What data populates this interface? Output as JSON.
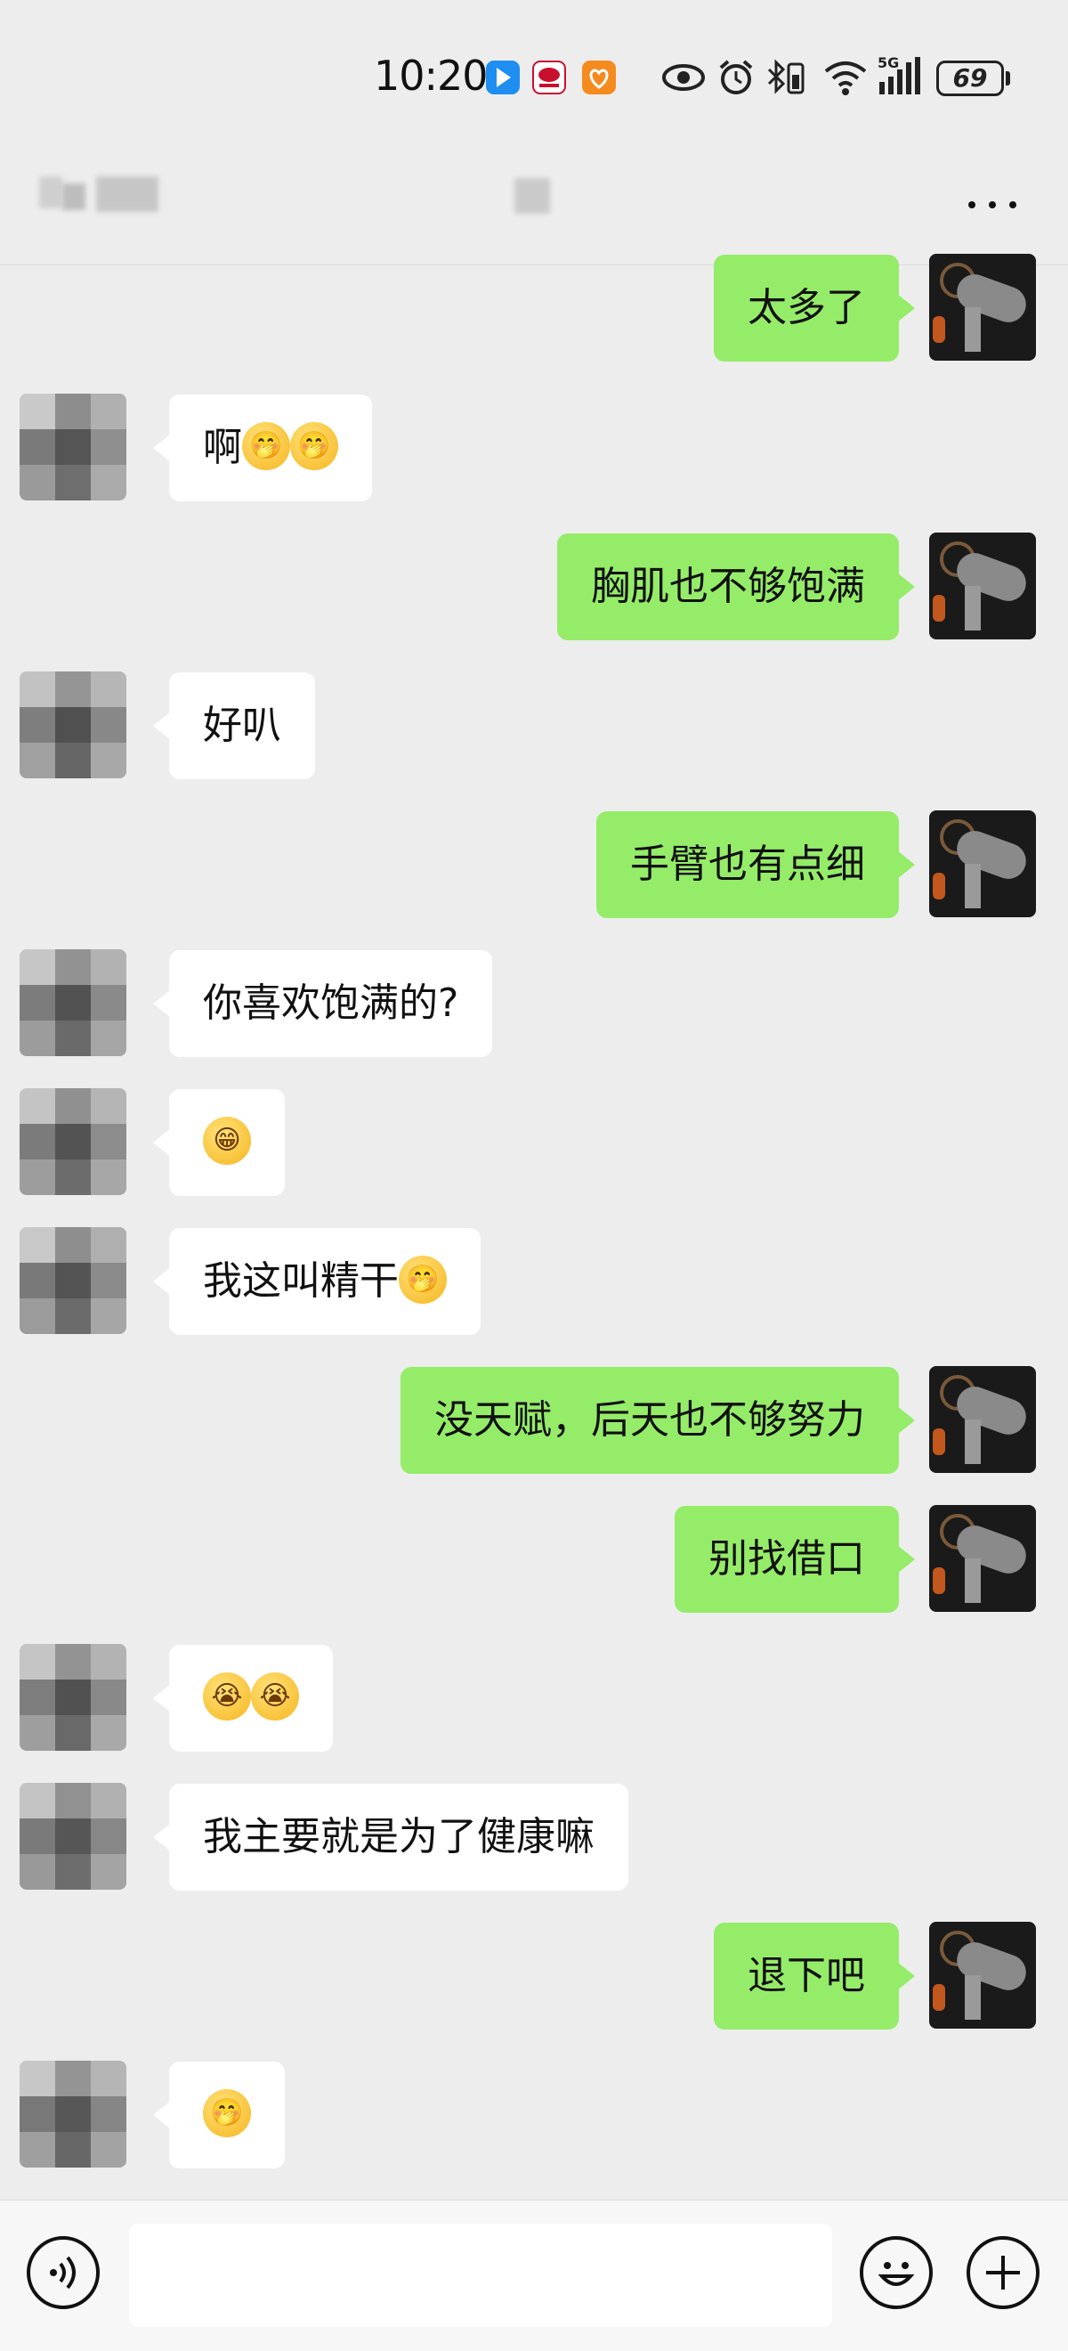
{
  "status_bar": {
    "time": "10:20",
    "network": "5G",
    "battery": "69",
    "icons": [
      "location-app-icon",
      "red-app-icon",
      "orange-app-icon",
      "eye-icon",
      "alarm-icon",
      "bluetooth-icon",
      "wifi-icon",
      "signal-icon"
    ]
  },
  "header": {
    "more_icon": "more-dots-icon"
  },
  "messages": [
    {
      "sender": "me",
      "text": "太多了"
    },
    {
      "sender": "other",
      "text": "啊",
      "emoji": [
        "🤭",
        "🤭"
      ]
    },
    {
      "sender": "me",
      "text": "胸肌也不够饱满"
    },
    {
      "sender": "other",
      "text": "好叭"
    },
    {
      "sender": "me",
      "text": "手臂也有点细"
    },
    {
      "sender": "other",
      "text": "你喜欢饱满的?"
    },
    {
      "sender": "other",
      "text": "",
      "emoji": [
        "😁"
      ]
    },
    {
      "sender": "other",
      "text": "我这叫精干",
      "emoji": [
        "🤭"
      ]
    },
    {
      "sender": "me",
      "text": "没天赋，后天也不够努力"
    },
    {
      "sender": "me",
      "text": "别找借口"
    },
    {
      "sender": "other",
      "text": "",
      "emoji": [
        "😭",
        "😭"
      ]
    },
    {
      "sender": "other",
      "text": "我主要就是为了健康嘛"
    },
    {
      "sender": "me",
      "text": "退下吧"
    },
    {
      "sender": "other",
      "text": "",
      "emoji": [
        "🤭"
      ]
    }
  ],
  "input_bar": {
    "voice_icon": "voice-icon",
    "emoji_icon": "emoji-icon",
    "plus_icon": "plus-icon",
    "value": ""
  },
  "colors": {
    "background": "#ededed",
    "my_bubble": "#95ec69",
    "other_bubble": "#ffffff"
  }
}
